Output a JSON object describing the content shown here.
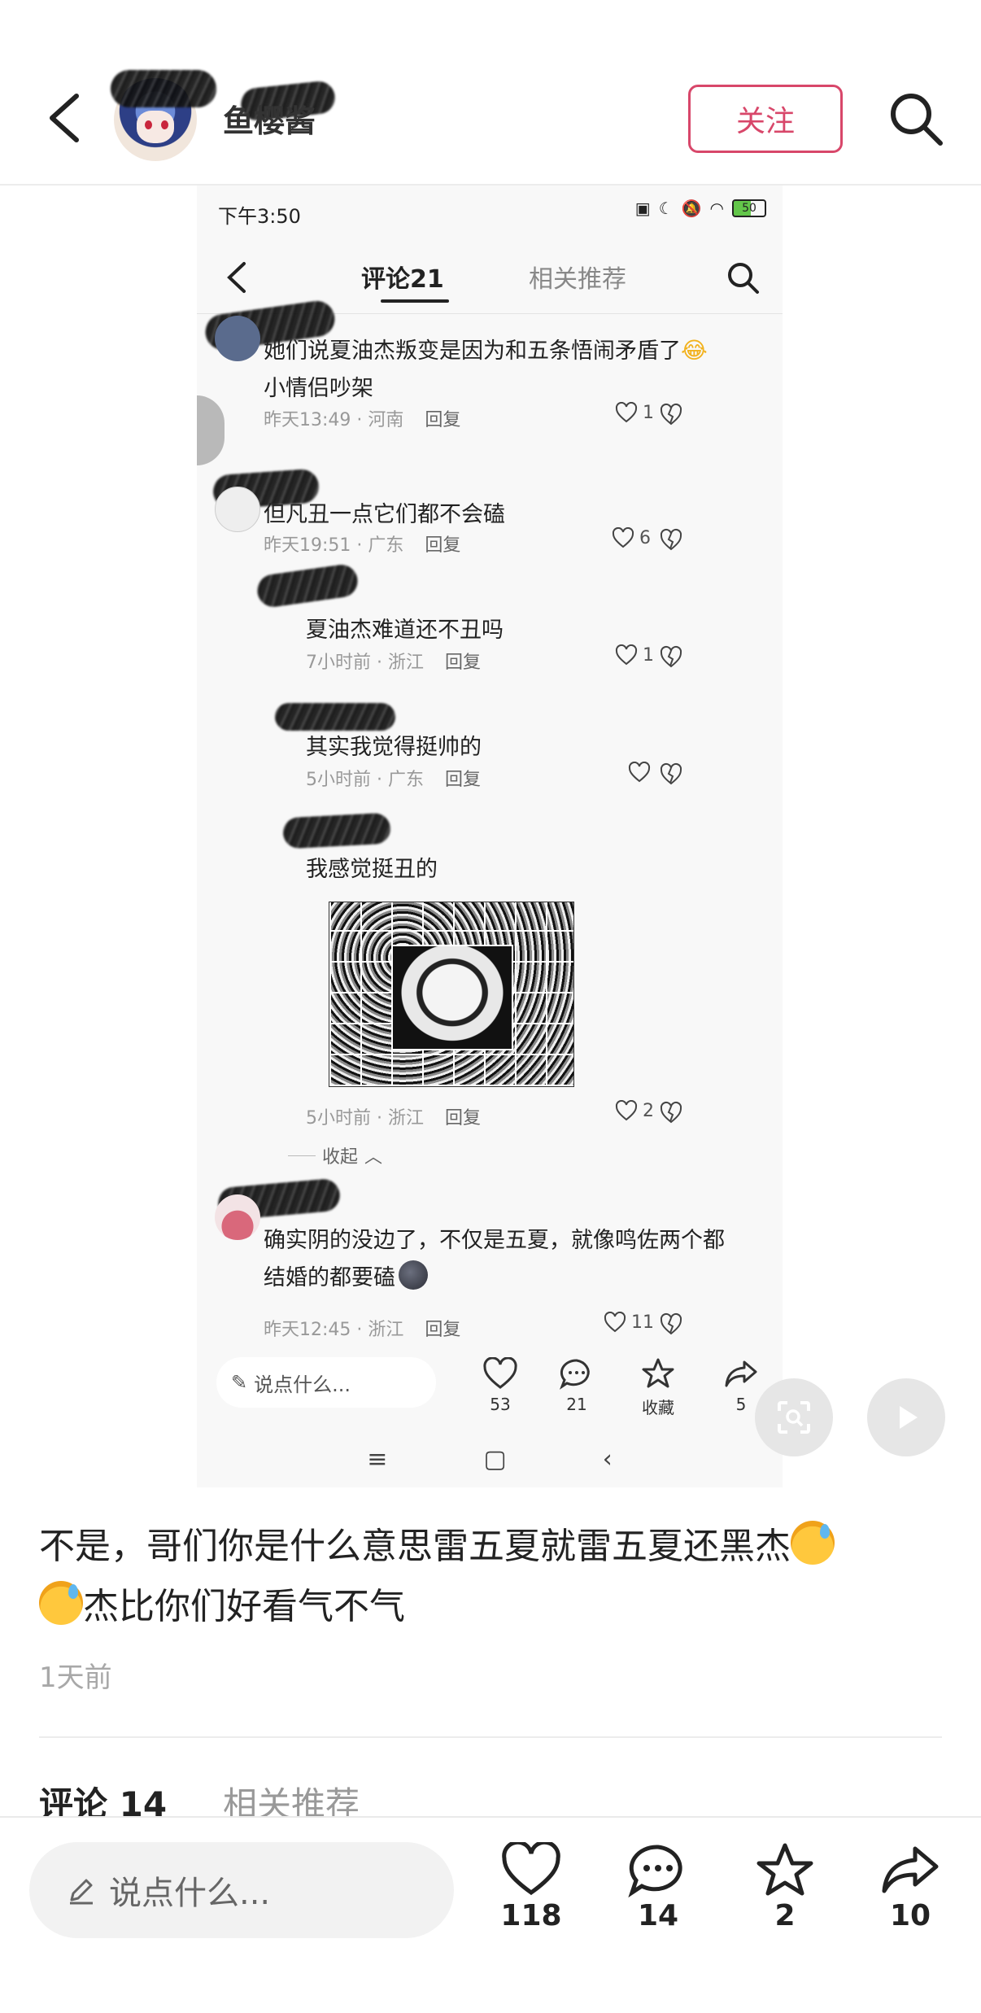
{
  "header": {
    "username": "鱼樱酱",
    "follow_label": "关注"
  },
  "screenshot": {
    "status_time": "下午3:50",
    "battery": "50",
    "tabs": {
      "active": "评论21",
      "other": "相关推荐"
    },
    "comments": [
      {
        "text_line1": "她们说夏油杰叛变是因为和五条悟闹矛盾了",
        "text_line2": "小情侣吵架",
        "time": "昨天13:49",
        "location": "河南",
        "reply": "回复",
        "likes": "1"
      },
      {
        "text_line1": "但凡丑一点它们都不会磕",
        "time": "昨天19:51",
        "location": "广东",
        "reply": "回复",
        "likes": "6"
      },
      {
        "text_line1": "夏油杰难道还不丑吗",
        "time": "7小时前",
        "location": "浙江",
        "reply": "回复",
        "likes": "1"
      },
      {
        "text_line1": "其实我觉得挺帅的",
        "time": "5小时前",
        "location": "广东",
        "reply": "回复",
        "likes": ""
      },
      {
        "text_line1": "我感觉挺丑的",
        "time": "5小时前",
        "location": "浙江",
        "reply": "回复",
        "likes": "2"
      },
      {
        "text_line1": "确实阴的没边了，不仅是五夏，就像鸣佐两个都",
        "text_line2": "结婚的都要磕",
        "time": "昨天12:45",
        "location": "浙江",
        "reply": "回复",
        "likes": "11"
      }
    ],
    "collapse_label": "收起",
    "input_placeholder": "说点什么...",
    "actions": {
      "likes": "53",
      "comments": "21",
      "collect": "收藏",
      "share": "5"
    }
  },
  "post": {
    "text_line1": "不是，哥们你是什么意思雷五夏就雷五夏还黑杰",
    "text_line2": "杰比你们好看气不气",
    "time": "1天前"
  },
  "tabs": {
    "comments": "评论 14",
    "related": "相关推荐"
  },
  "bottom_bar": {
    "input_placeholder": "说点什么...",
    "likes": "118",
    "comments": "14",
    "collects": "2",
    "shares": "10"
  }
}
